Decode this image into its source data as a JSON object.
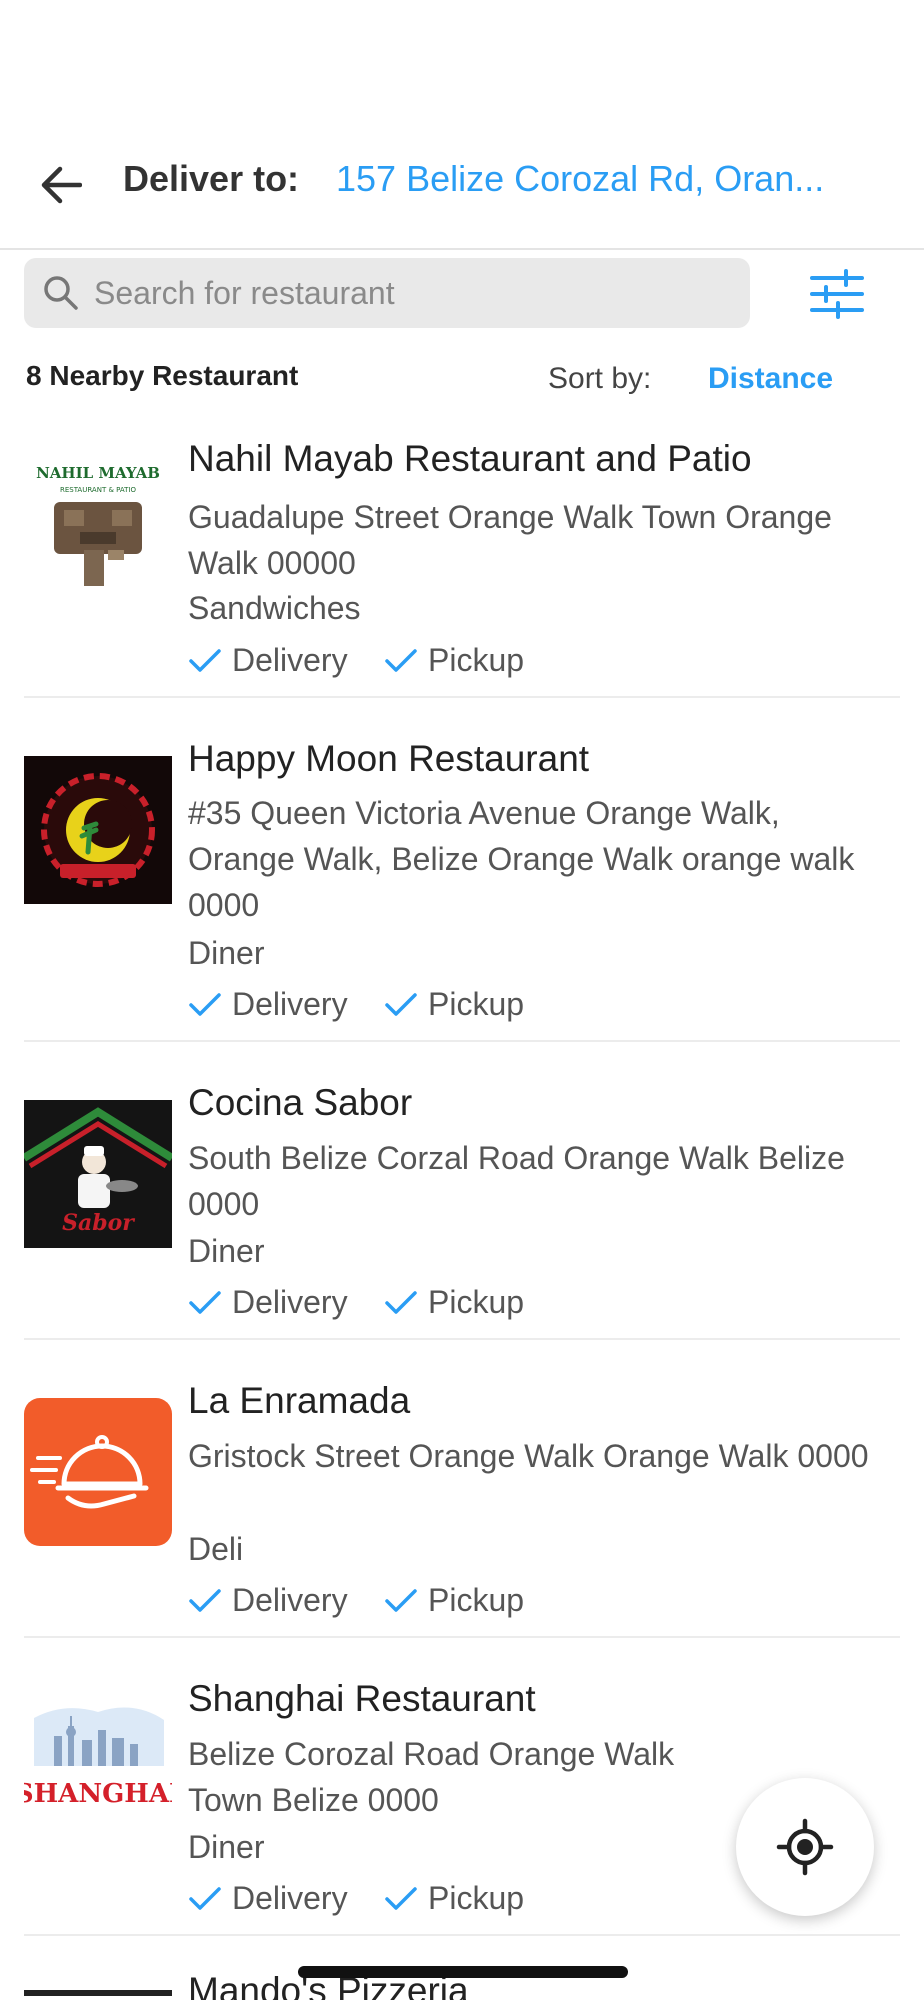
{
  "header": {
    "back_icon": "arrow-left-icon",
    "deliver_label": "Deliver to:",
    "address": "157 Belize Corozal Rd, Oran..."
  },
  "search": {
    "placeholder": "Search for restaurant",
    "value": "",
    "filter_icon": "sliders-icon"
  },
  "list_header": {
    "count_label": "8 Nearby Restaurant",
    "sort_label": "Sort by:",
    "sort_value": "Distance"
  },
  "colors": {
    "accent": "#2a9df4",
    "text": "#222222",
    "muted": "#555555",
    "orange_logo": "#f25c2a"
  },
  "restaurants": [
    {
      "name": "Nahil Mayab Restaurant and Patio",
      "address": "Guadalupe Street Orange Walk Town Orange Walk 00000",
      "category": "Sandwiches",
      "delivery": "Delivery",
      "pickup": "Pickup",
      "logo_text": "NAHIL MAYAB",
      "logo_subtext": "RESTAURANT & PATIO"
    },
    {
      "name": "Happy Moon Restaurant",
      "address": "#35 Queen Victoria Avenue Orange Walk, Orange Walk, Belize Orange Walk orange walk 0000",
      "category": "Diner",
      "delivery": "Delivery",
      "pickup": "Pickup"
    },
    {
      "name": "Cocina Sabor",
      "address": "South Belize Corzal Road Orange Walk Belize 0000",
      "category": "Diner",
      "delivery": "Delivery",
      "pickup": "Pickup"
    },
    {
      "name": "La Enramada",
      "address": "Gristock Street Orange Walk Orange Walk 0000",
      "category": "Deli",
      "delivery": "Delivery",
      "pickup": "Pickup"
    },
    {
      "name": "Shanghai Restaurant",
      "address": "Belize Corozal Road Orange Walk Town Belize 0000",
      "category": "Diner",
      "delivery": "Delivery",
      "pickup": "Pickup",
      "logo_text": "SHANGHAI"
    },
    {
      "name": "Mando's Pizzeria"
    }
  ],
  "locate_icon": "crosshair-location-icon"
}
